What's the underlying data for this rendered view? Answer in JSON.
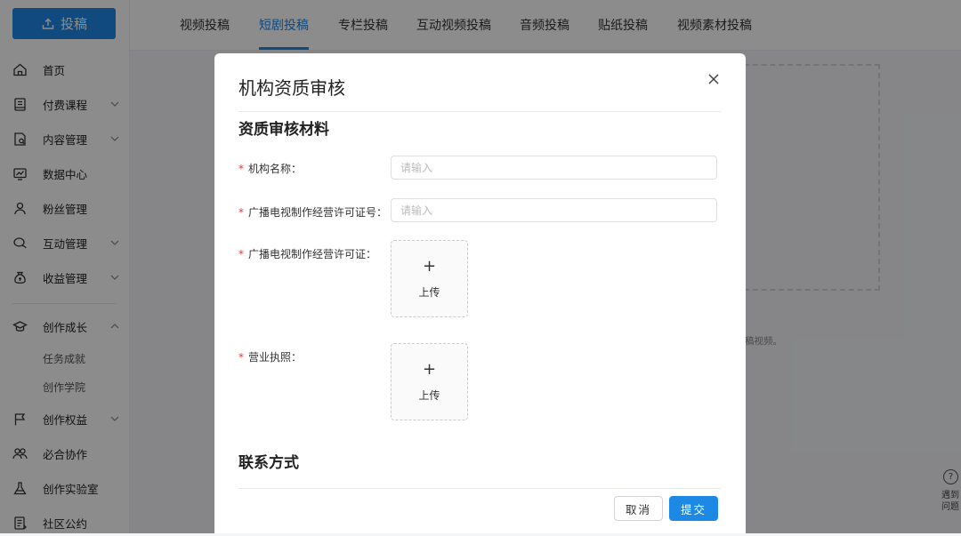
{
  "sidebar": {
    "upload_label": "投稿",
    "items": [
      {
        "label": "首页"
      },
      {
        "label": "付费课程"
      },
      {
        "label": "内容管理"
      },
      {
        "label": "数据中心"
      },
      {
        "label": "粉丝管理"
      },
      {
        "label": "互动管理"
      },
      {
        "label": "收益管理"
      },
      {
        "label": "创作成长"
      },
      {
        "label": "创作权益"
      },
      {
        "label": "必合协作"
      },
      {
        "label": "创作实验室"
      },
      {
        "label": "社区公约"
      }
    ],
    "sub_items": [
      {
        "label": "任务成就"
      },
      {
        "label": "创作学院"
      }
    ]
  },
  "tabs": [
    {
      "label": "视频投稿"
    },
    {
      "label": "短剧投稿"
    },
    {
      "label": "专栏投稿"
    },
    {
      "label": "互动视频投稿"
    },
    {
      "label": "音频投稿"
    },
    {
      "label": "贴纸投稿"
    },
    {
      "label": "视频素材投稿"
    }
  ],
  "active_tab": "短剧投稿",
  "background": {
    "note_fragment": "稿视频。",
    "help_lines": [
      "遇到",
      "问题"
    ]
  },
  "modal": {
    "title": "机构资质审核",
    "section_materials": "资质审核材料",
    "section_contact": "联系方式",
    "required_mark": "*",
    "fields": {
      "org_name": {
        "label": "机构名称：",
        "placeholder": "请输入"
      },
      "license_no": {
        "label": "广播电视制作经营许可证号：",
        "placeholder": "请输入"
      },
      "license_img": {
        "label": "广播电视制作经营许可证：",
        "upload_plus": "+",
        "upload_text": "上传"
      },
      "business_license": {
        "label": "营业执照：",
        "upload_plus": "+",
        "upload_text": "上传"
      }
    },
    "cancel_label": "取消",
    "submit_label": "提交"
  },
  "colors": {
    "accent": "#1e88e5",
    "required": "#e53935"
  }
}
